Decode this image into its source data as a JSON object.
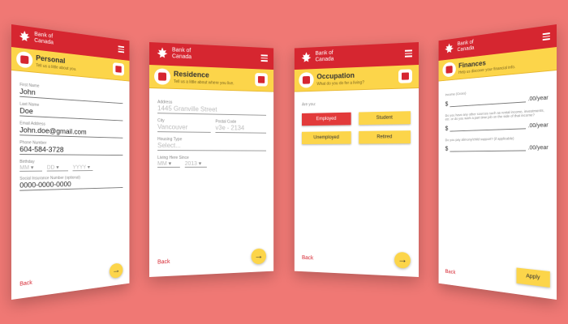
{
  "brand": {
    "line1": "Bank of",
    "line2": "Canada"
  },
  "screens": {
    "personal": {
      "title": "Personal",
      "subtitle": "Tell us a little about you.",
      "first_label": "First Name",
      "first_value": "John",
      "last_label": "Last Name",
      "last_value": "Doe",
      "email_label": "Email Address",
      "email_value": "John.doe@gmail.com",
      "phone_label": "Phone Number",
      "phone_value": "604-584-3728",
      "bday_label": "Birthday",
      "mm": "MM",
      "dd": "DD",
      "yyyy": "YYYY",
      "sin_label": "Social Insurance Number (optional)",
      "sin_value": "0000-0000-0000",
      "back": "Back"
    },
    "residence": {
      "title": "Residence",
      "subtitle": "Tell us a little about where you live.",
      "address_label": "Address",
      "address_value": "1445 Granville Street",
      "city_label": "City",
      "city_value": "Vancouver",
      "postal_label": "Postal Code",
      "postal_value": "v3e - 2134",
      "housing_label": "Housing Type",
      "housing_value": "Select...",
      "since_label": "Living Here Since",
      "since_mm": "MM",
      "since_year": "2013",
      "back": "Back"
    },
    "occupation": {
      "title": "Occupation",
      "subtitle": "What do you do for a living?",
      "question": "Are you:",
      "options": [
        "Employed",
        "Student",
        "Unemployed",
        "Retired"
      ],
      "back": "Back"
    },
    "finances": {
      "title": "Finances",
      "subtitle": "Help us discover your financial info.",
      "q1": "Income (Gross)",
      "q2": "Do you have any other sources such as rental income, investments, etc. or do you work a part time job on the side of that income?",
      "q3": "Do you pay alimony/child support? (if applicable)",
      "currency": "$",
      "period": ".00/year",
      "back": "Back",
      "apply": "Apply"
    }
  }
}
